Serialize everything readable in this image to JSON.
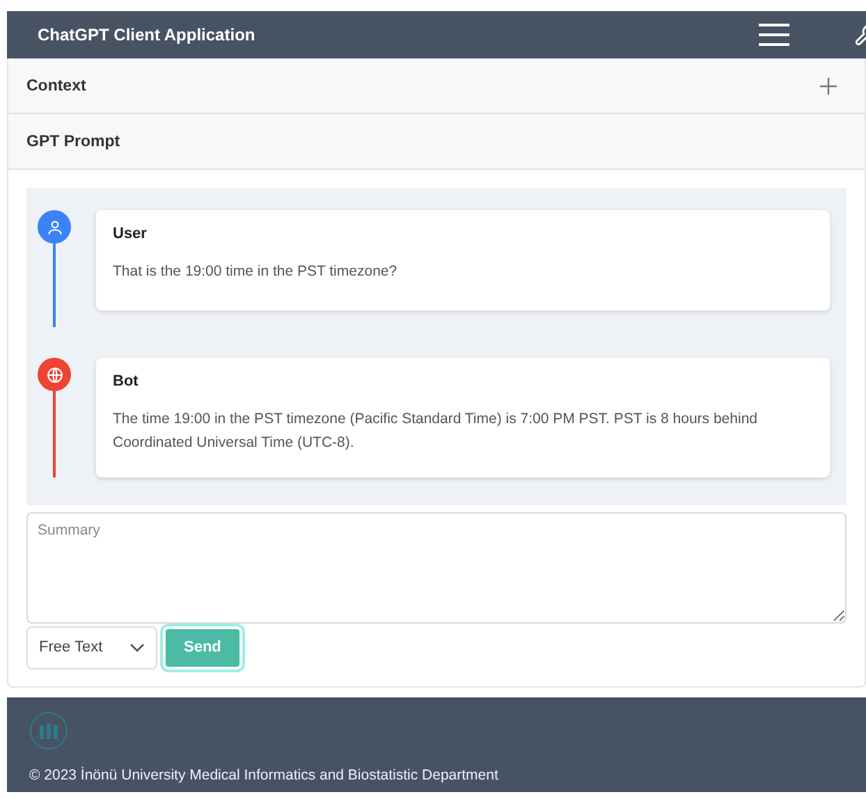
{
  "navbar": {
    "title": "ChatGPT Client Application"
  },
  "accordion": [
    {
      "title": "Context",
      "expanded": false
    },
    {
      "title": "GPT Prompt",
      "expanded": true
    }
  ],
  "messages": [
    {
      "kind": "user",
      "color": "#3b82f6",
      "author": "User",
      "text": "That is the 19:00 time in the PST timezone?"
    },
    {
      "kind": "bot",
      "color": "#ef4433",
      "author": "Bot",
      "text": "The time 19:00 in the PST timezone (Pacific Standard Time) is 7:00 PM PST. PST is 8 hours behind Coordinated Universal Time (UTC-8)."
    }
  ],
  "summary": {
    "placeholder": "Summary"
  },
  "mode_select": {
    "value": "Free Text"
  },
  "send_button": {
    "label": "Send"
  },
  "footer": {
    "copyright": "© 2023 İnönü University Medical Informatics and Biostatistic Department"
  }
}
